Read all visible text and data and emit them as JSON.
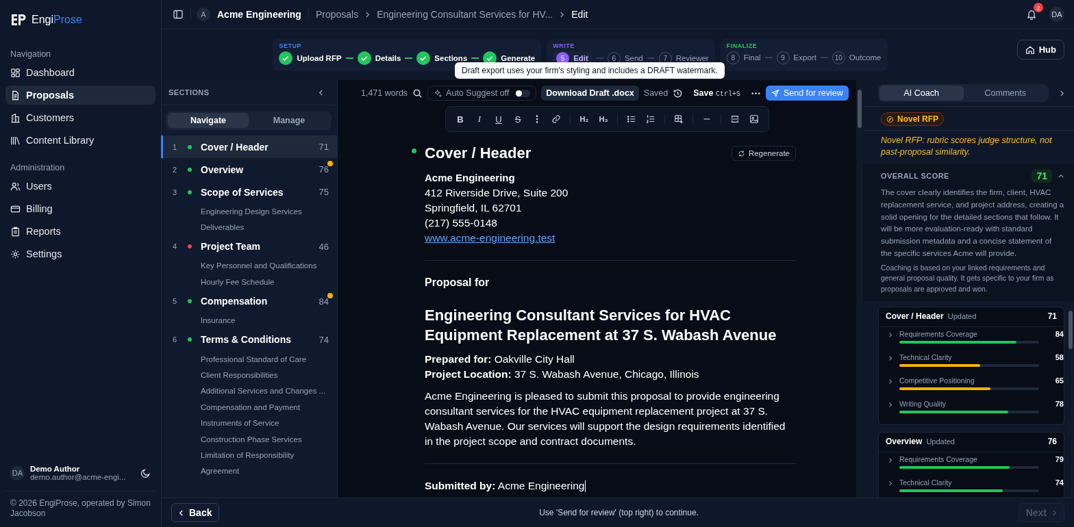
{
  "brand": {
    "first": "Engi",
    "second": "Prose"
  },
  "sidebar": {
    "groups": [
      {
        "label": "Navigation",
        "items": [
          {
            "label": "Dashboard",
            "kind": "grid",
            "selected": false
          },
          {
            "label": "Proposals",
            "kind": "doc",
            "selected": true
          },
          {
            "label": "Customers",
            "kind": "building",
            "selected": false
          },
          {
            "label": "Content Library",
            "kind": "library",
            "selected": false
          }
        ]
      },
      {
        "label": "Administration",
        "items": [
          {
            "label": "Users",
            "kind": "users",
            "selected": false
          },
          {
            "label": "Billing",
            "kind": "card",
            "selected": false
          },
          {
            "label": "Reports",
            "kind": "clipboard",
            "selected": false
          },
          {
            "label": "Settings",
            "kind": "gear",
            "selected": false
          }
        ]
      }
    ],
    "user": {
      "initials": "DA",
      "name": "Demo Author",
      "email": "demo.author@acme-engi..."
    },
    "footer": "© 2026 EngiProse, operated by Simon Jacobson"
  },
  "topbar": {
    "org_initial": "A",
    "org": "Acme Engineering",
    "breadcrumbs": [
      "Proposals",
      "Engineering Consultant Services for HV...",
      "Edit"
    ],
    "notifications": "2",
    "avatar": "DA"
  },
  "stepper": [
    {
      "phase": "SETUP",
      "color": "#3b82f6",
      "steps": [
        {
          "label": "Upload RFP",
          "done": true,
          "current": false
        },
        {
          "label": "Details",
          "done": true,
          "current": false
        },
        {
          "label": "Sections",
          "done": true,
          "current": false
        },
        {
          "label": "Generate",
          "done": true,
          "current": false
        }
      ]
    },
    {
      "phase": "WRITE",
      "color": "#8b5cf6",
      "steps": [
        {
          "number": "5",
          "label": "Edit",
          "done": false,
          "current": true
        },
        {
          "number": "6",
          "label": "Send",
          "done": false,
          "current": false
        },
        {
          "number": "7",
          "label": "Reviewer",
          "done": false,
          "current": false
        }
      ]
    },
    {
      "phase": "FINALIZE",
      "color": "#22c55e",
      "steps": [
        {
          "number": "8",
          "label": "Final",
          "done": false,
          "current": false
        },
        {
          "number": "9",
          "label": "Export",
          "done": false,
          "current": false
        },
        {
          "number": "10",
          "label": "Outcome",
          "done": false,
          "current": false
        }
      ]
    }
  ],
  "hub_button": "Hub",
  "tooltip": "Draft export uses your firm's styling and includes a DRAFT watermark.",
  "sections_panel": {
    "title": "SECTIONS",
    "modes": [
      {
        "label": "Navigate",
        "selected": true
      },
      {
        "label": "Manage",
        "selected": false
      }
    ],
    "items": [
      {
        "number": "1",
        "title": "Cover / Header",
        "score": "71",
        "color": "#22c55e",
        "flagged": false,
        "selected": true
      },
      {
        "number": "2",
        "title": "Overview",
        "score": "76",
        "color": "#22c55e",
        "flagged": true,
        "selected": false
      },
      {
        "number": "3",
        "title": "Scope of Services",
        "score": "75",
        "color": "#22c55e",
        "flagged": false,
        "selected": false,
        "children": [
          {
            "title": "Engineering Design Services"
          },
          {
            "title": "Deliverables"
          }
        ]
      },
      {
        "number": "4",
        "title": "Project Team",
        "score": "46",
        "color": "#ef4444",
        "flagged": false,
        "selected": false,
        "children": [
          {
            "title": "Key Personnel and Qualifications"
          },
          {
            "title": "Hourly Fee Schedule"
          }
        ]
      },
      {
        "number": "5",
        "title": "Compensation",
        "score": "84",
        "color": "#22c55e",
        "flagged": true,
        "selected": false,
        "children": [
          {
            "title": "Insurance"
          }
        ]
      },
      {
        "number": "6",
        "title": "Terms & Conditions",
        "score": "74",
        "color": "#22c55e",
        "flagged": false,
        "selected": false,
        "children": [
          {
            "title": "Professional Standard of Care"
          },
          {
            "title": "Client Responsibilities"
          },
          {
            "title": "Additional Services and Changes ..."
          },
          {
            "title": "Compensation and Payment"
          },
          {
            "title": "Instruments of Service"
          },
          {
            "title": "Construction Phase Services"
          },
          {
            "title": "Limitation of Responsibility"
          },
          {
            "title": "Agreement"
          }
        ]
      }
    ]
  },
  "editor_toolbar": {
    "word_count": "1,471 words",
    "auto_suggest": {
      "label": "Auto Suggest off",
      "on": false
    },
    "download": "Download Draft .docx",
    "save_state": "Saved",
    "save": "Save",
    "shortcut": "Ctrl+S",
    "send": "Send for review"
  },
  "format_tools": [
    [
      {
        "kind": "bold",
        "label": "B"
      },
      {
        "kind": "italic",
        "label": "I"
      },
      {
        "kind": "underline",
        "label": "U"
      },
      {
        "kind": "strike",
        "label": "S"
      },
      {
        "kind": "more"
      },
      {
        "kind": "link"
      }
    ],
    [
      {
        "kind": "heading",
        "label": "H₂"
      },
      {
        "kind": "heading",
        "label": "H₃"
      }
    ],
    [
      {
        "kind": "bullets"
      },
      {
        "kind": "numbers"
      }
    ],
    [
      {
        "kind": "table"
      }
    ],
    [
      {
        "kind": "rule"
      }
    ],
    [
      {
        "kind": "pagebreak"
      },
      {
        "kind": "image"
      }
    ]
  ],
  "document": {
    "title": "Cover / Header",
    "color": "#22c55e",
    "regenerate": "Regenerate",
    "address": [
      "Acme Engineering",
      "412 Riverside Drive, Suite 200",
      "Springfield, IL 62701",
      "(217) 555-0148"
    ],
    "website": "www.acme-engineering.test",
    "proposal_for": "Proposal for",
    "proposal_title": "Engineering Consultant Services for HVAC Equipment Replacement at 37 S. Wabash Avenue",
    "facts": [
      "**Prepared for:** Oakville City Hall",
      "**Project Location:** 37 S. Wabash Avenue, Chicago, Illinois"
    ],
    "body": "Acme Engineering is pleased to submit this proposal to provide engineering consultant services for the HVAC equipment replacement project at 37 S. Wabash Avenue. Our services will support the design requirements identified in the project scope and contract documents.",
    "submitted": "**Submitted by:** Acme Engineering"
  },
  "coach": {
    "tabs": [
      {
        "label": "AI Coach",
        "selected": true
      },
      {
        "label": "Comments",
        "selected": false
      }
    ],
    "badge": "Novel RFP",
    "note": "Novel RFP: rubric scores judge structure, not past-proposal similarity.",
    "overall": {
      "label": "OVERALL SCORE",
      "score": "71",
      "expanded": true,
      "summary": "The cover clearly identifies the firm, client, HVAC replacement service, and project address, creating a solid opening for the detailed sections that follow. It will be more evaluation-ready with standard submission metadata and a concise statement of the specific services Acme will provide.",
      "disclaimer": "Coaching is based on your linked requirements and general proposal quality. It gets specific to your firm as proposals are approved and won."
    },
    "cards": [
      {
        "title": "Cover / Header",
        "status": "Updated",
        "score": "71",
        "criteria": [
          {
            "name": "Requirements Coverage",
            "score": "84",
            "level": 0.84,
            "color": "#22c55e"
          },
          {
            "name": "Technical Clarity",
            "score": "58",
            "level": 0.58,
            "color": "#f5b400"
          },
          {
            "name": "Competitive Positioning",
            "score": "65",
            "level": 0.65,
            "color": "#f5b400"
          },
          {
            "name": "Writing Quality",
            "score": "78",
            "level": 0.78,
            "color": "#22c55e"
          }
        ]
      },
      {
        "title": "Overview",
        "status": "Updated",
        "score": "76",
        "criteria": [
          {
            "name": "Requirements Coverage",
            "score": "79",
            "level": 0.79,
            "color": "#22c55e"
          },
          {
            "name": "Technical Clarity",
            "score": "74",
            "level": 0.74,
            "color": "#22c55e"
          }
        ]
      }
    ]
  },
  "bottom_bar": {
    "back": "Back",
    "hint": "Use 'Send for review' (top right) to continue.",
    "next": {
      "label": "Next",
      "disabled": true
    }
  }
}
